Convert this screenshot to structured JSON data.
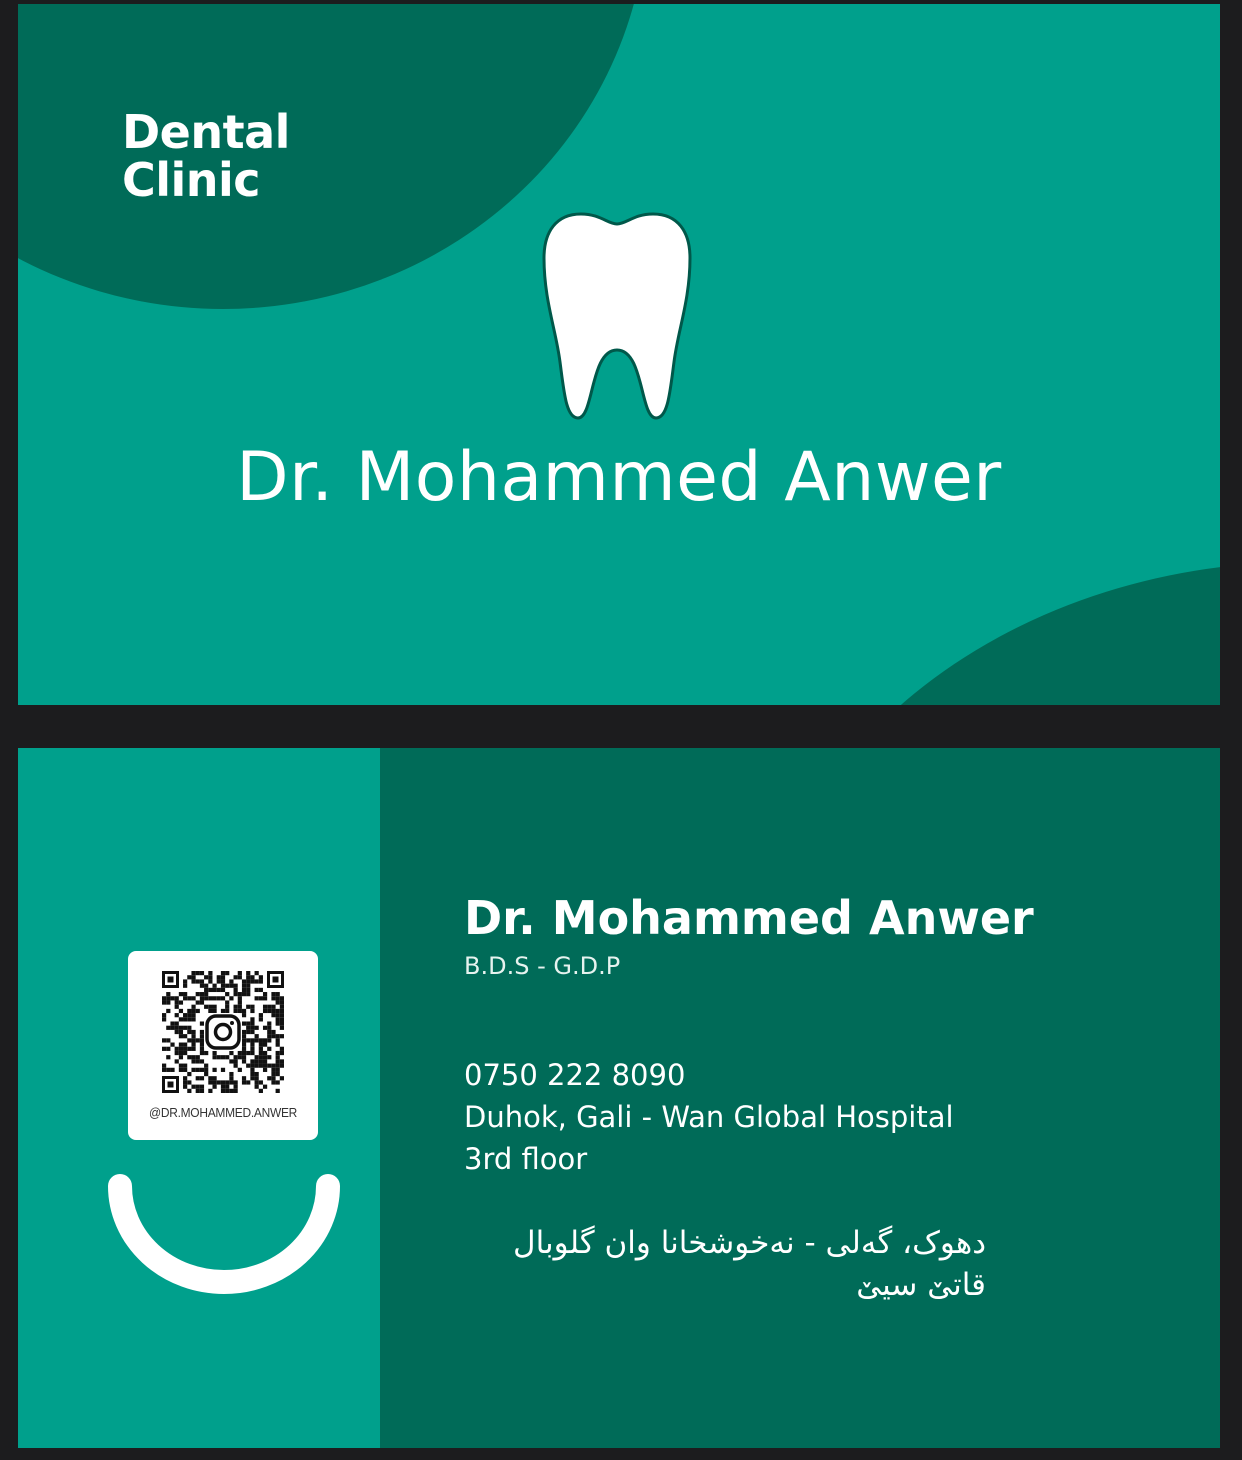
{
  "colors": {
    "teal": "#00a08c",
    "dark": "#006b58",
    "background": "#1c1c1e",
    "white": "#ffffff"
  },
  "front": {
    "clinic_line1": "Dental",
    "clinic_line2": "Clinic",
    "doctor_name": "Dr. Mohammed Anwer",
    "tooth_icon": "tooth-icon"
  },
  "back": {
    "doctor_name": "Dr. Mohammed Anwer",
    "credentials": "B.D.S - G.D.P",
    "phone": "0750 222 8090",
    "address_line1": "Duhok, Gali - Wan Global Hospital",
    "address_line2": "3rd floor",
    "kurdish_line1": "دهوک، گەلی - نەخوشخانا وان گلوبال",
    "kurdish_line2": "قاتێ سیێ",
    "qr_handle": "@DR.MOHAMMED.ANWER",
    "qr_icon": "instagram-icon",
    "smile_icon": "smile-icon"
  }
}
